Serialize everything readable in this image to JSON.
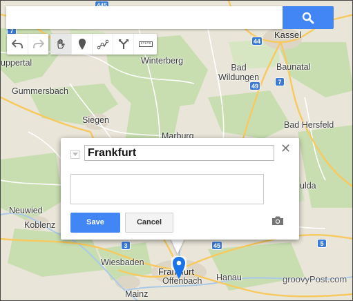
{
  "map": {
    "places": [
      {
        "id": "kassel",
        "name": "Kassel"
      },
      {
        "id": "wuppertal",
        "name": "uppertal"
      },
      {
        "id": "winterberg",
        "name": "Winterberg"
      },
      {
        "id": "bad-wildungen",
        "name": "Bad\nWildungen"
      },
      {
        "id": "baunatal",
        "name": "Baunatal"
      },
      {
        "id": "gummersbach",
        "name": "Gummersbach"
      },
      {
        "id": "siegen",
        "name": "Siegen"
      },
      {
        "id": "marburg",
        "name": "Marburg"
      },
      {
        "id": "bad-hersfeld",
        "name": "Bad Hersfeld"
      },
      {
        "id": "fulda",
        "name": "ulda"
      },
      {
        "id": "neuwied",
        "name": "Neuwied"
      },
      {
        "id": "koblenz",
        "name": "Koblenz"
      },
      {
        "id": "wiesbaden",
        "name": "Wiesbaden"
      },
      {
        "id": "frankfurt",
        "name": "Frankfurt"
      },
      {
        "id": "offenbach",
        "name": "Offenbach"
      },
      {
        "id": "hanau",
        "name": "Hanau"
      },
      {
        "id": "mainz",
        "name": "Mainz"
      }
    ],
    "shields": [
      "445",
      "44",
      "49",
      "7",
      "5",
      "3",
      "45",
      "7"
    ]
  },
  "search": {
    "value": "",
    "placeholder": ""
  },
  "toolbar": {
    "buttons": [
      {
        "name": "undo",
        "icon": "undo-arrow-icon"
      },
      {
        "name": "redo",
        "icon": "redo-arrow-icon"
      },
      {
        "name": "select",
        "icon": "hand-icon",
        "active": true
      },
      {
        "name": "add-marker",
        "icon": "marker-icon"
      },
      {
        "name": "draw-line",
        "icon": "draw-line-icon"
      },
      {
        "name": "directions",
        "icon": "directions-icon"
      },
      {
        "name": "measure",
        "icon": "ruler-icon"
      }
    ]
  },
  "popup": {
    "title": "Frankfurt",
    "description": "",
    "save_label": "Save",
    "cancel_label": "Cancel",
    "close_glyph": "✕"
  },
  "watermark": "groovyPost.com",
  "colors": {
    "accent": "#4285f4",
    "marker": "#1a73e8",
    "map_bg": "#e8e4d6",
    "forest": "#c9dfb0"
  }
}
